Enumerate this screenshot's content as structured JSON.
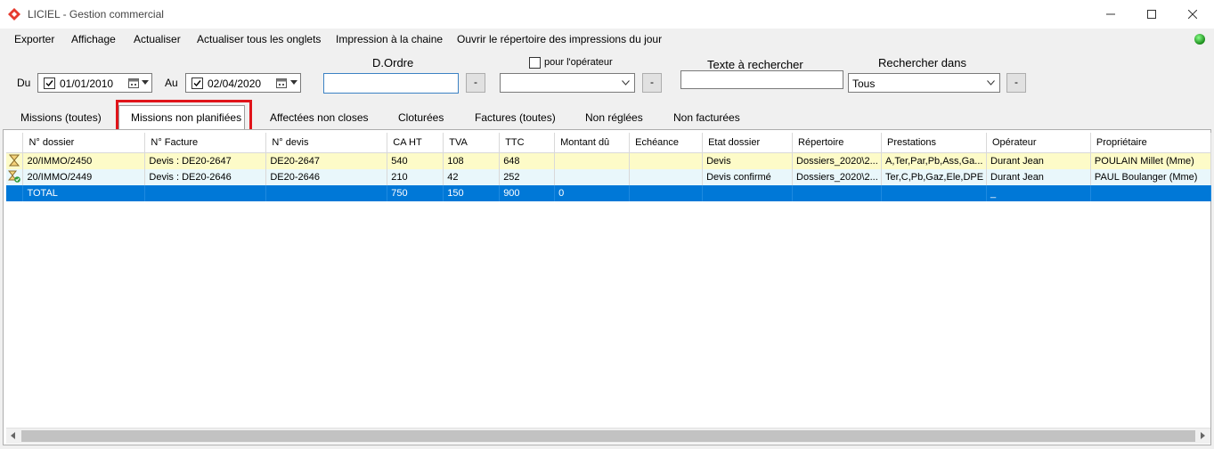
{
  "window": {
    "title": "LICIEL - Gestion commercial"
  },
  "menu": [
    "Exporter",
    "Affichage",
    "Actualiser",
    "Actualiser tous les onglets",
    "Impression à la chaine",
    "Ouvrir le répertoire des impressions du jour"
  ],
  "filters": {
    "du_label": "Du",
    "du_value": "01/01/2010",
    "au_label": "Au",
    "au_value": "02/04/2020",
    "ordre_label": "D.Ordre",
    "ordre_value": "",
    "minus": "-",
    "operateur_label": "pour l'opérateur",
    "operateur_value": "",
    "texte_label": "Texte à rechercher",
    "texte_value": "",
    "rechercher_label": "Rechercher dans",
    "rechercher_value": "Tous"
  },
  "tabs": [
    "Missions (toutes)",
    "Missions non planifiées",
    "Affectées non closes",
    "Cloturées",
    "Factures (toutes)",
    "Non réglées",
    "Non facturées"
  ],
  "active_tab": "Missions non planifiées",
  "table": {
    "columns": [
      "N° dossier",
      "N° Facture",
      "N° devis",
      "CA HT",
      "TVA",
      "TTC",
      "Montant dû",
      "Echéance",
      "Etat dossier",
      "Répertoire",
      "Prestations",
      "Opérateur",
      "Propriétaire"
    ],
    "rows": [
      [
        "20/IMMO/2450",
        "Devis : DE20-2647",
        "DE20-2647",
        "540",
        "108",
        "648",
        "",
        "",
        "Devis",
        "Dossiers_2020\\2...",
        "A,Ter,Par,Pb,Ass,Ga...",
        "Durant Jean",
        "POULAIN Millet (Mme)"
      ],
      [
        "20/IMMO/2449",
        "Devis : DE20-2646",
        "DE20-2646",
        "210",
        "42",
        "252",
        "",
        "",
        "Devis confirmé",
        "Dossiers_2020\\2...",
        "Ter,C,Pb,Gaz,Ele,DPE",
        "Durant Jean",
        "PAUL Boulanger (Mme)"
      ],
      [
        "TOTAL",
        "",
        "",
        "750",
        "150",
        "900",
        "0",
        "",
        "",
        "",
        "",
        "_",
        ""
      ]
    ]
  },
  "colors": {
    "accent": "#0078d7",
    "highlight": "#e0141a",
    "row_pending": "#fdfbc8",
    "row_confirmed": "#e9f7fb"
  }
}
